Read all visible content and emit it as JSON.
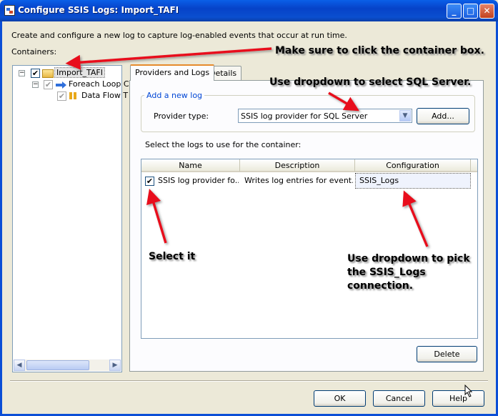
{
  "window": {
    "title": "Configure SSIS Logs: Import_TAFI",
    "controls": {
      "minimize": "_",
      "maximize": "□",
      "close": "✕"
    }
  },
  "intro_text": "Create and configure a new log to capture log-enabled events that occur at run time.",
  "containers_label": "Containers:",
  "tree": {
    "root": {
      "label": "Import_TAFI",
      "checked": true,
      "expander": "−"
    },
    "child": {
      "label": "Foreach Loop C",
      "checked": true,
      "expander": "−"
    },
    "grandchild": {
      "label": "Data Flow T",
      "checked": true
    }
  },
  "tabs": [
    {
      "label": "Providers and Logs",
      "active": true
    },
    {
      "label": "Details",
      "active": false
    }
  ],
  "add_log": {
    "group_title": "Add a new log",
    "provider_label": "Provider type:",
    "provider_value": "SSIS log provider for SQL Server",
    "add_button": "Add..."
  },
  "logs": {
    "select_label": "Select the logs to use for the container:",
    "columns": [
      "Name",
      "Description",
      "Configuration"
    ],
    "rows": [
      {
        "checked": true,
        "name": "SSIS log provider fo...",
        "description": "Writes log entries for event...",
        "configuration": "SSIS_Logs"
      }
    ],
    "delete_button": "Delete"
  },
  "footer": {
    "ok": "OK",
    "cancel": "Cancel",
    "help": "Help"
  },
  "annotations": {
    "container_box": "Make sure to click the container box.",
    "dropdown_sql": "Use dropdown to select SQL Server.",
    "select_it": "Select it",
    "pick_connection": "Use dropdown to pick the SSIS_Logs connection.",
    "arrow_color": "#E8101A"
  }
}
